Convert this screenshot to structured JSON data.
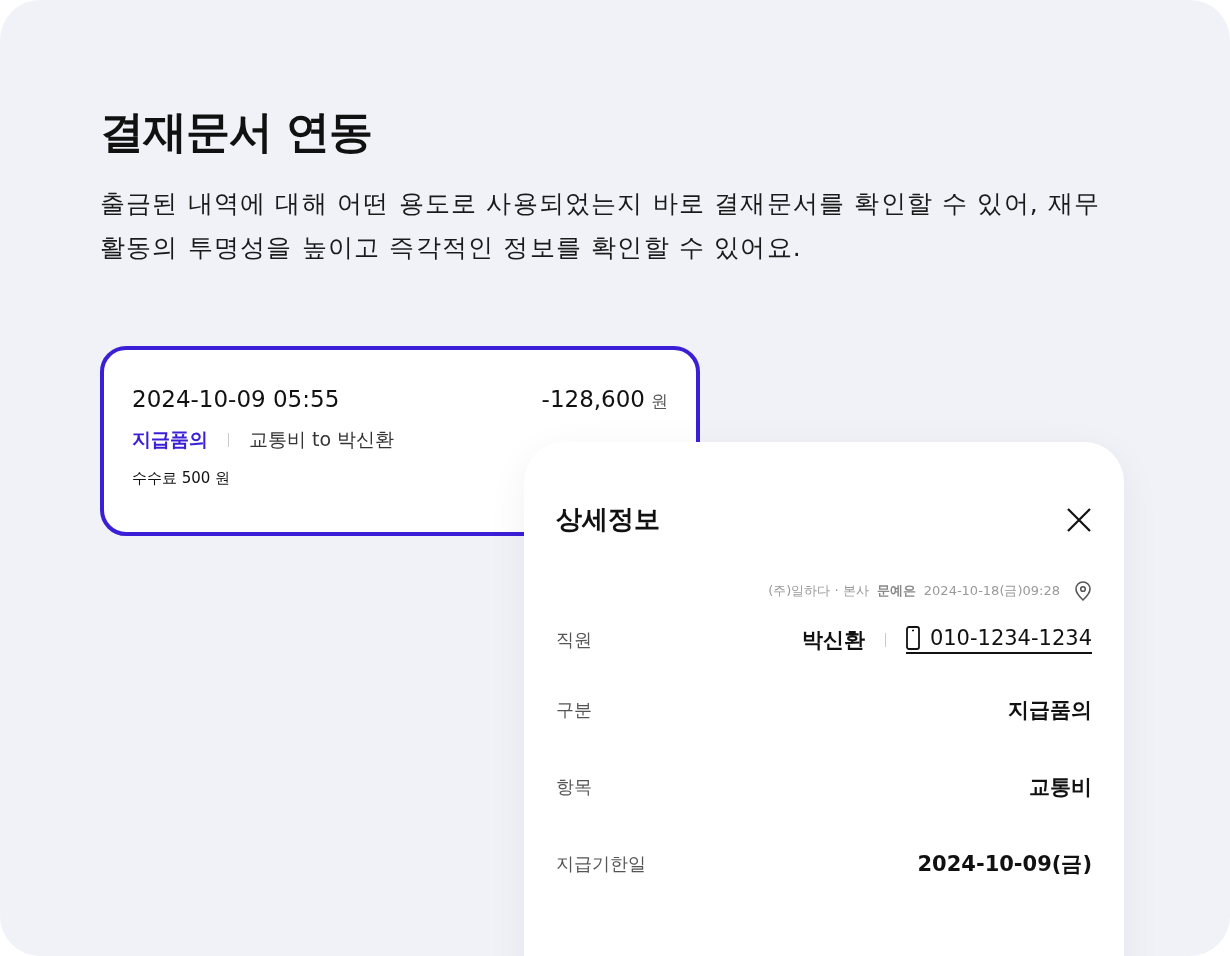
{
  "heading": "결재문서 연동",
  "description": "출금된 내역에 대해 어떤 용도로 사용되었는지 바로 결재문서를 확인할 수 있어, 재무활동의 투명성을 높이고 즉각적인 정보를 확인할 수 있어요.",
  "transaction": {
    "selected": true,
    "datetime": "2024-10-09 05:55",
    "amount": "-128,600",
    "currency": "원",
    "category": "지급품의",
    "memo": "교통비 to 박신환",
    "fee": "수수료 500 원"
  },
  "detail": {
    "title": "상세정보",
    "company": "(주)일하다 · 본사",
    "author": "문예은",
    "timestamp": "2024-10-18(금)09:28",
    "rows": [
      {
        "kind": "contact",
        "label": "직원",
        "value": "박신환",
        "phone": "010-1234-1234"
      },
      {
        "kind": "text",
        "label": "구분",
        "value": "지급품의"
      },
      {
        "kind": "text",
        "label": "항목",
        "value": "교통비"
      },
      {
        "kind": "text",
        "label": "지급기한일",
        "value": "2024-10-09(금)"
      }
    ]
  }
}
